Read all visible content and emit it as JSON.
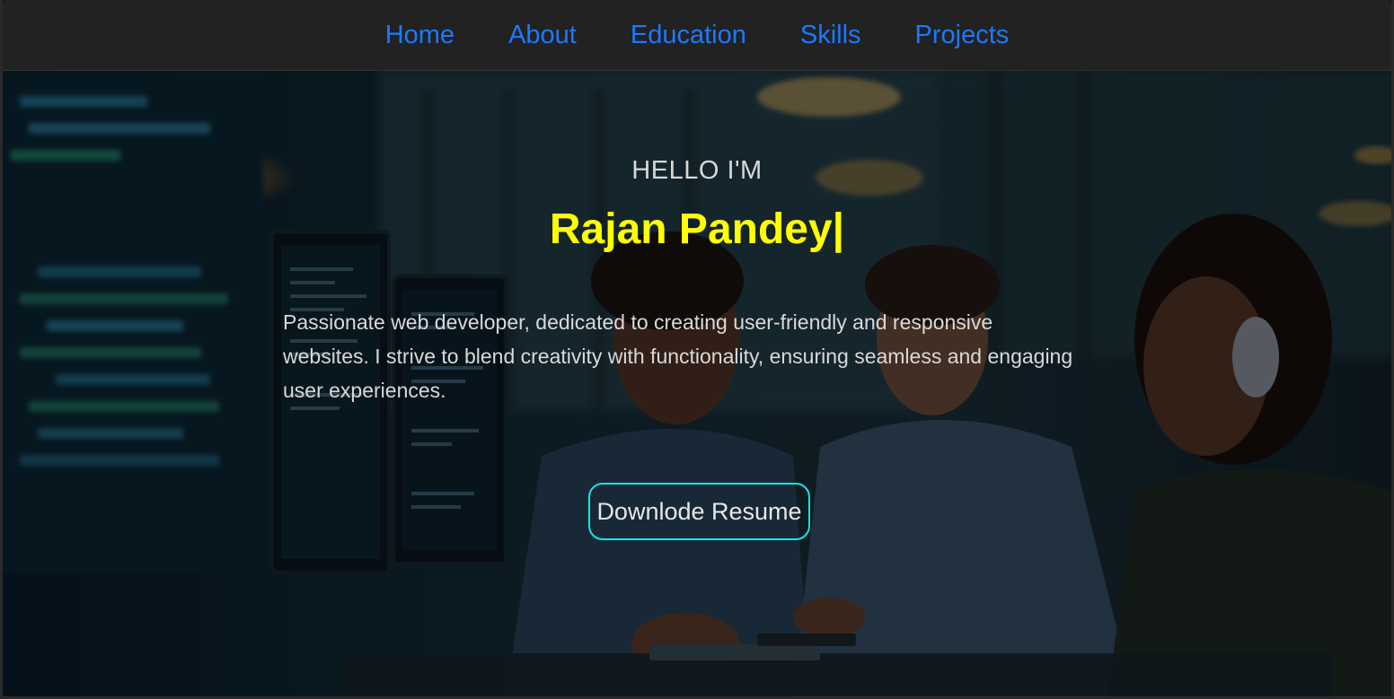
{
  "nav": {
    "items": [
      {
        "label": "Home"
      },
      {
        "label": "About"
      },
      {
        "label": "Education"
      },
      {
        "label": "Skills"
      },
      {
        "label": "Projects"
      }
    ]
  },
  "hero": {
    "greeting": "HELLO I'M",
    "name": "Rajan Pandey",
    "cursor": "|",
    "bio": "Passionate web developer, dedicated to creating user-friendly and responsive websites. I strive to blend creativity with functionality, ensuring seamless and engaging user experiences.",
    "resume_button": "Downlode Resume"
  },
  "colors": {
    "nav_link": "#1e78ff",
    "name": "#ffff00",
    "button_border": "#19e3e9",
    "navbar_bg": "#222222"
  }
}
